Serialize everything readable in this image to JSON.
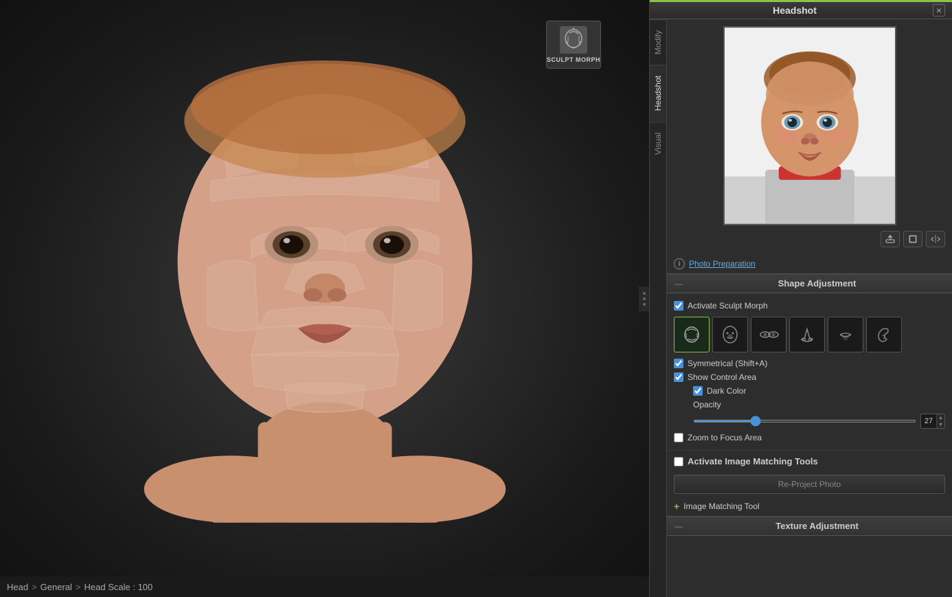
{
  "title": "Headshot",
  "close_btn": "×",
  "tabs": [
    {
      "id": "modify",
      "label": "Modify",
      "active": false
    },
    {
      "id": "headshot",
      "label": "Headshot",
      "active": true
    },
    {
      "id": "visual",
      "label": "Visual",
      "active": false
    }
  ],
  "sculpt_morph": {
    "label": "SCULPT MORPH"
  },
  "photo_prep": {
    "info": "i",
    "link": "Photo Preparation"
  },
  "photo_controls": {
    "export": "↑",
    "crop": "⊡",
    "flip": "⇆"
  },
  "shape_adjustment": {
    "title": "Shape Adjustment",
    "collapse": "—",
    "activate_sculpt_morph": {
      "checked": true,
      "label": "Activate Sculpt Morph"
    },
    "morph_icons": [
      {
        "id": "head",
        "active": true,
        "title": "Head"
      },
      {
        "id": "face",
        "active": false,
        "title": "Face"
      },
      {
        "id": "eyes",
        "active": false,
        "title": "Eyes"
      },
      {
        "id": "nose",
        "active": false,
        "title": "Nose"
      },
      {
        "id": "mouth",
        "active": false,
        "title": "Mouth"
      },
      {
        "id": "ear",
        "active": false,
        "title": "Ear"
      }
    ],
    "symmetrical": {
      "checked": true,
      "label": "Symmetrical (Shift+A)"
    },
    "show_control_area": {
      "checked": true,
      "label": "Show Control Area"
    },
    "dark_color": {
      "checked": true,
      "label": "Dark Color"
    },
    "opacity": {
      "label": "Opacity",
      "value": 27,
      "min": 0,
      "max": 100
    },
    "zoom_to_focus": {
      "checked": false,
      "label": "Zoom to Focus Area"
    }
  },
  "image_matching": {
    "activate_label": "Activate Image Matching Tools",
    "activate_checked": false,
    "reproject_label": "Re-Project Photo",
    "tool_label": "Image Matching Tool",
    "plus": "+"
  },
  "texture_adjustment": {
    "title": "Texture Adjustment",
    "collapse": "—"
  },
  "status_bar": {
    "head": "Head",
    "sep1": ">",
    "general": "General",
    "sep2": ">",
    "head_scale": "Head Scale",
    "colon": ":",
    "value": "100"
  },
  "viewport": {
    "handle_dots": 3
  }
}
